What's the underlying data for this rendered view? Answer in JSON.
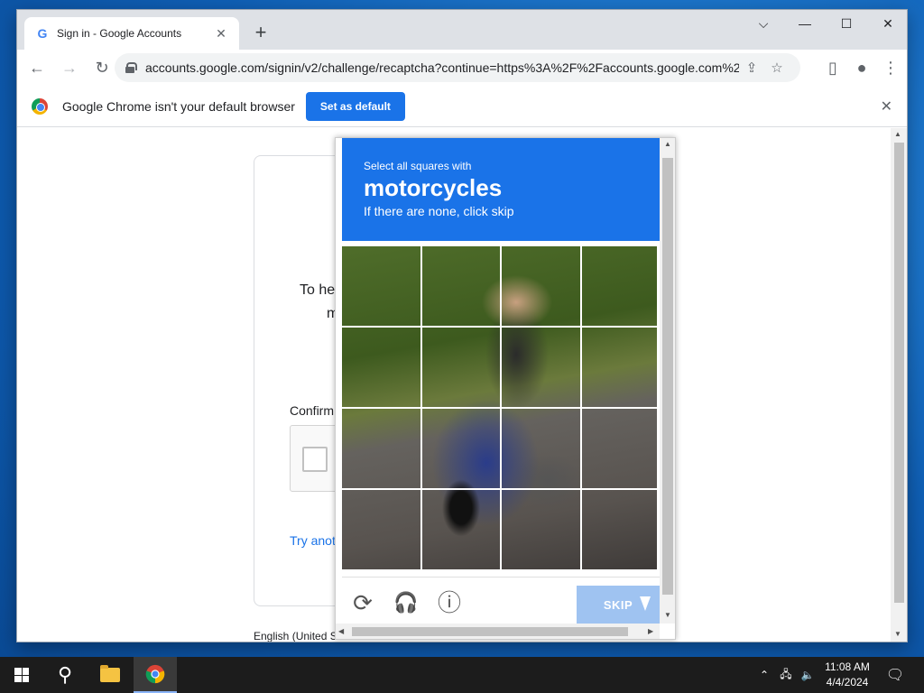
{
  "browser": {
    "tab_title": "Sign in - Google Accounts",
    "tab_favicon": "G",
    "new_tab": "+",
    "url": "accounts.google.com/signin/v2/challenge/recaptcha?continue=https%3A%2F%2Faccounts.google.com%2...",
    "icons": {
      "tab_list": "⌵",
      "minimize": "—",
      "maximize": "☐",
      "close": "✕",
      "back": "←",
      "forward": "→",
      "reload": "↻",
      "share": "⇪",
      "bookmark": "☆",
      "sidepanel": "▯",
      "profile": "●",
      "menu": "⋮"
    }
  },
  "infobar": {
    "message": "Google Chrome isn't your default browser",
    "button": "Set as default",
    "close": "✕"
  },
  "signin_card": {
    "help_text_1": "To hel",
    "help_text_2": "m",
    "confirm_label": "Confirm",
    "try_another": "Try anot",
    "footer_language": "English (United S"
  },
  "captcha": {
    "instruction_line1": "Select all squares with",
    "target": "motorcycles",
    "instruction_line3": "If there are none, click skip",
    "skip_button": "SKIP",
    "icons": {
      "reload": "⟳",
      "audio": "🎧",
      "info": "ⓘ"
    }
  },
  "taskbar": {
    "search_icon": "⚲",
    "time": "11:08 AM",
    "date": "4/4/2024",
    "tray_chevron": "⌃",
    "network": "🖧",
    "volume": "🔈",
    "notifications": "🗨"
  }
}
